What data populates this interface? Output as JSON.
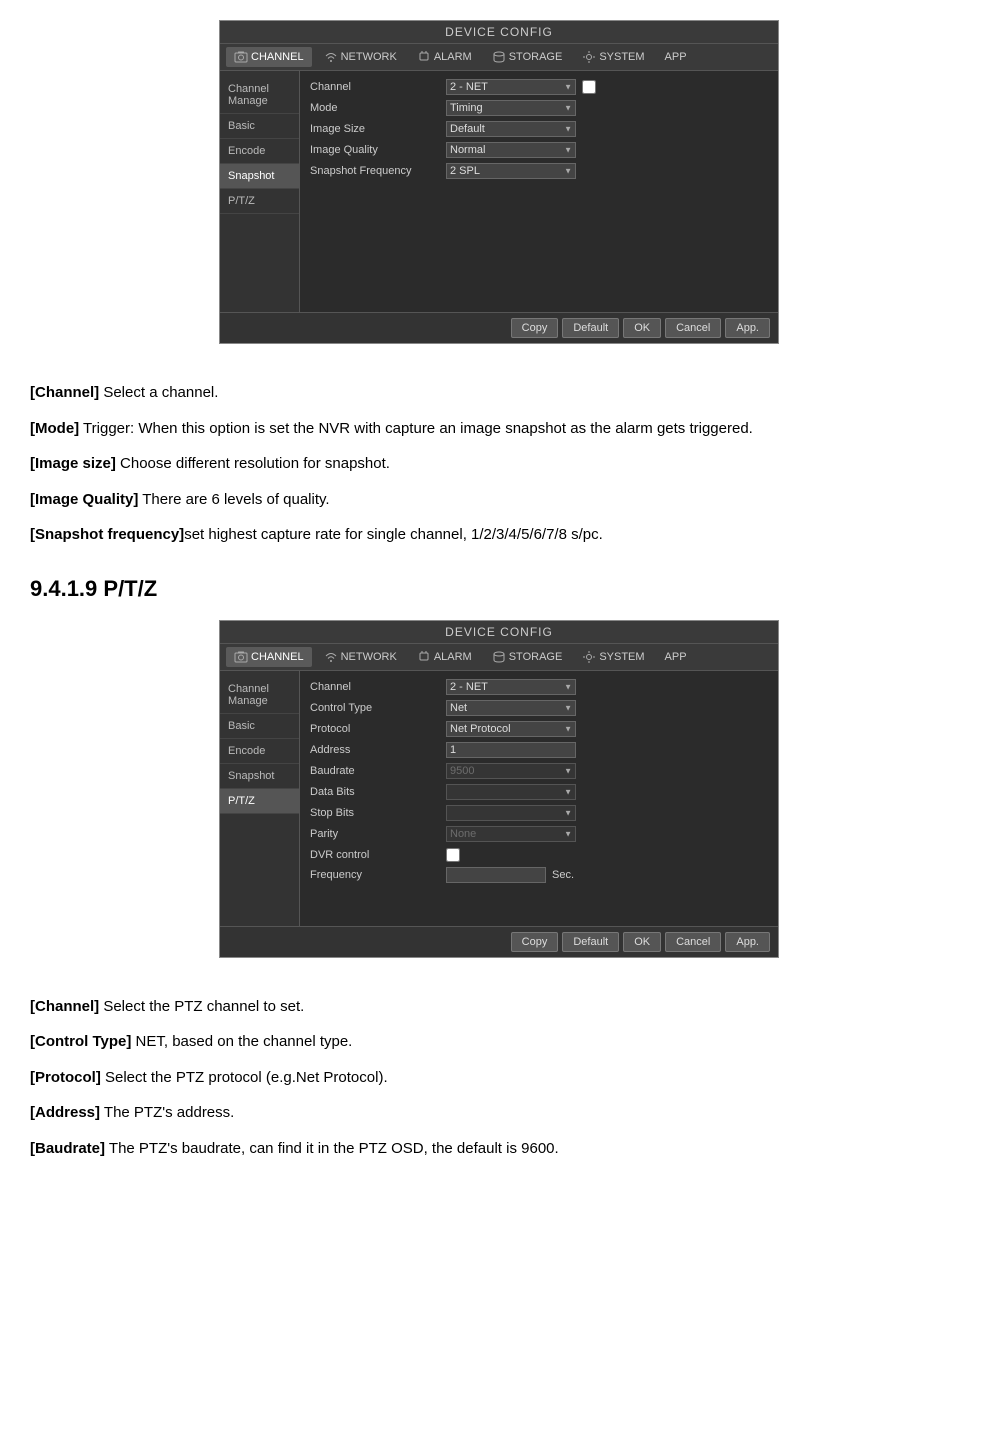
{
  "panel1": {
    "title": "DEVICE CONFIG",
    "nav": [
      {
        "label": "CHANNEL",
        "active": true,
        "icon": "camera"
      },
      {
        "label": "NETWORK",
        "active": false,
        "icon": "wifi"
      },
      {
        "label": "ALARM",
        "active": false,
        "icon": "bell"
      },
      {
        "label": "STORAGE",
        "active": false,
        "icon": "storage"
      },
      {
        "label": "SYSTEM",
        "active": false,
        "icon": "system"
      },
      {
        "label": "APP",
        "active": false,
        "icon": "app"
      }
    ],
    "sidebar": [
      {
        "label": "Channel Manage",
        "active": false
      },
      {
        "label": "Basic",
        "active": false
      },
      {
        "label": "Encode",
        "active": false
      },
      {
        "label": "Snapshot",
        "active": true
      },
      {
        "label": "P/T/Z",
        "active": false
      }
    ],
    "fields": [
      {
        "label": "Channel",
        "type": "select",
        "value": "2 - NET"
      },
      {
        "label": "Mode",
        "type": "select",
        "value": "Timing"
      },
      {
        "label": "Image Size",
        "type": "select",
        "value": "Default"
      },
      {
        "label": "Image Quality",
        "type": "select",
        "value": "Normal"
      },
      {
        "label": "Snapshot Frequency",
        "type": "select",
        "value": "2 SPL"
      }
    ],
    "footer_buttons": [
      "Copy",
      "Default",
      "OK",
      "Cancel",
      "App."
    ]
  },
  "panel2": {
    "title": "DEVICE CONFIG",
    "nav": [
      {
        "label": "CHANNEL",
        "active": true,
        "icon": "camera"
      },
      {
        "label": "NETWORK",
        "active": false,
        "icon": "wifi"
      },
      {
        "label": "ALARM",
        "active": false,
        "icon": "bell"
      },
      {
        "label": "STORAGE",
        "active": false,
        "icon": "storage"
      },
      {
        "label": "SYSTEM",
        "active": false,
        "icon": "system"
      },
      {
        "label": "APP",
        "active": false,
        "icon": "app"
      }
    ],
    "sidebar": [
      {
        "label": "Channel Manage",
        "active": false
      },
      {
        "label": "Basic",
        "active": false
      },
      {
        "label": "Encode",
        "active": false
      },
      {
        "label": "Snapshot",
        "active": false
      },
      {
        "label": "P/T/Z",
        "active": true
      }
    ],
    "fields": [
      {
        "label": "Channel",
        "type": "select",
        "value": "2 - NET"
      },
      {
        "label": "Control Type",
        "type": "select",
        "value": "Net"
      },
      {
        "label": "Protocol",
        "type": "select",
        "value": "Net Protocol"
      },
      {
        "label": "Address",
        "type": "input",
        "value": "1"
      },
      {
        "label": "Baudrate",
        "type": "select",
        "value": "9500",
        "disabled": true
      },
      {
        "label": "Data Bits",
        "type": "select",
        "value": "",
        "disabled": true
      },
      {
        "label": "Stop Bits",
        "type": "select",
        "value": "",
        "disabled": true
      },
      {
        "label": "Parity",
        "type": "select",
        "value": "None",
        "disabled": true
      },
      {
        "label": "DVR control",
        "type": "checkbox"
      },
      {
        "label": "Frequency",
        "type": "input_sec",
        "value": ""
      }
    ],
    "footer_buttons": [
      "Copy",
      "Default",
      "OK",
      "Cancel",
      "App."
    ]
  },
  "doc": {
    "section1_items": [
      {
        "term": "[Channel]",
        "text": " Select a channel."
      },
      {
        "term": "[Mode]",
        "text": " Trigger: When this option is set the NVR with capture an image snapshot as the alarm gets triggered."
      },
      {
        "term": "[Image size]",
        "text": " Choose different resolution for snapshot."
      },
      {
        "term": "[Image Quality]",
        "text": " There are 6 levels of quality."
      },
      {
        "term": "[Snapshot frequency]",
        "text": "set highest capture rate for single channel, 1/2/3/4/5/6/7/8 s/pc."
      }
    ],
    "section_heading": "9.4.1.9 P/T/Z",
    "section2_items": [
      {
        "term": "[Channel]",
        "text": " Select the PTZ channel to set."
      },
      {
        "term": "[Control Type]",
        "text": " NET, based on the channel type."
      },
      {
        "term": "[Protocol]",
        "text": " Select the PTZ protocol (e.g.Net Protocol)."
      },
      {
        "term": "[Address]",
        "text": " The PTZ's address."
      },
      {
        "term": "[Baudrate]",
        "text": " The PTZ's baudrate, can find it in the PTZ OSD, the default is 9600."
      }
    ]
  }
}
